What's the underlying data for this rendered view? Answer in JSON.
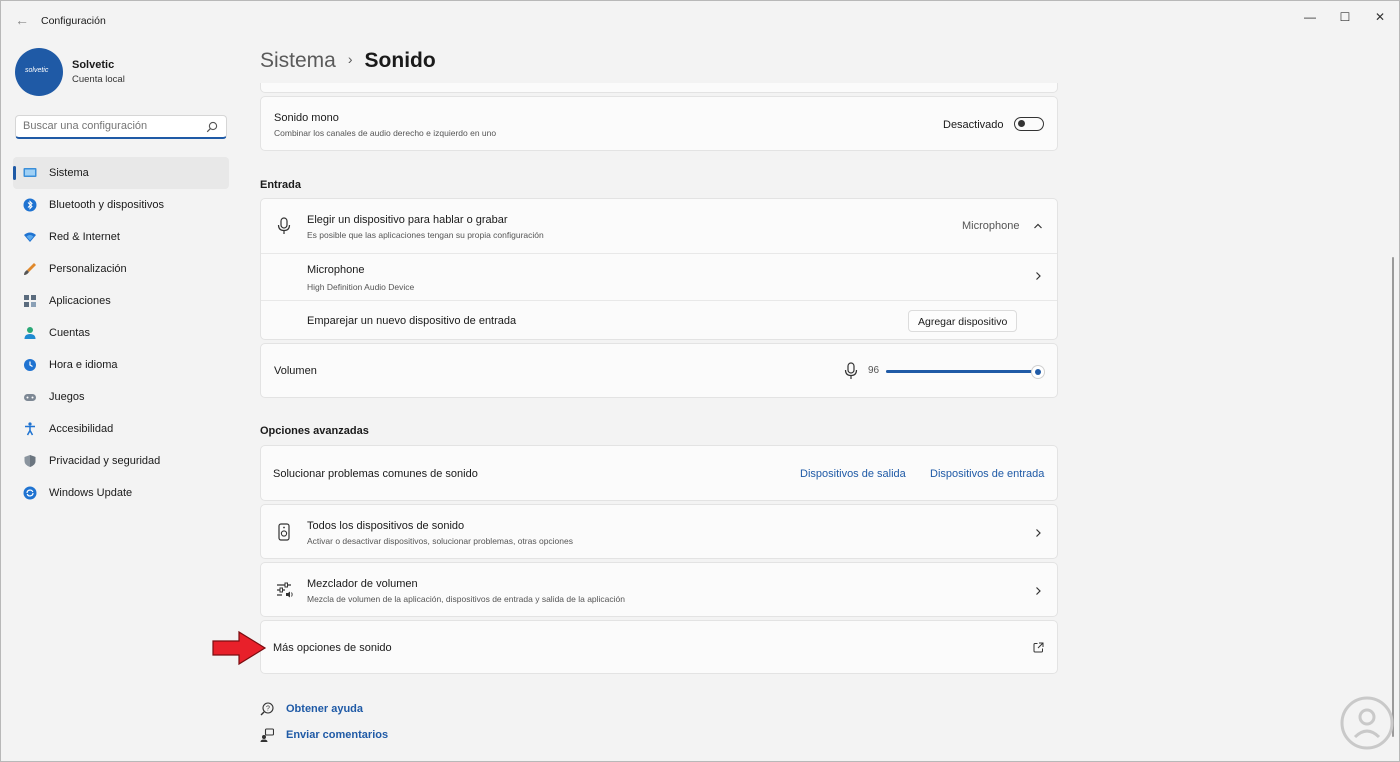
{
  "window": {
    "title": "Configuración",
    "back_icon": "arrow-left-icon",
    "controls": [
      "minimize-icon",
      "maximize-icon",
      "close-icon"
    ]
  },
  "user": {
    "avatar_text": "solvetic",
    "name": "Solvetic",
    "account_type": "Cuenta local"
  },
  "search": {
    "placeholder": "Buscar una configuración",
    "icon": "search-icon"
  },
  "sidebar": {
    "items": [
      {
        "label": "Sistema",
        "icon": "monitor-icon",
        "active": true
      },
      {
        "label": "Bluetooth y dispositivos",
        "icon": "bluetooth-icon"
      },
      {
        "label": "Red & Internet",
        "icon": "wifi-icon"
      },
      {
        "label": "Personalización",
        "icon": "brush-icon"
      },
      {
        "label": "Aplicaciones",
        "icon": "apps-icon"
      },
      {
        "label": "Cuentas",
        "icon": "person-icon"
      },
      {
        "label": "Hora e idioma",
        "icon": "clock-globe-icon"
      },
      {
        "label": "Juegos",
        "icon": "gamepad-icon"
      },
      {
        "label": "Accesibilidad",
        "icon": "accessibility-icon"
      },
      {
        "label": "Privacidad y seguridad",
        "icon": "shield-icon"
      },
      {
        "label": "Windows Update",
        "icon": "update-icon"
      }
    ]
  },
  "breadcrumb": {
    "parent": "Sistema",
    "separator": "›",
    "current": "Sonido"
  },
  "mono": {
    "title": "Sonido mono",
    "subtitle": "Combinar los canales de audio derecho e izquierdo en uno",
    "state_label": "Desactivado",
    "enabled": false
  },
  "input_section": {
    "heading": "Entrada",
    "choose": {
      "title": "Elegir un dispositivo para hablar o grabar",
      "subtitle": "Es posible que las aplicaciones tengan su propia configuración",
      "selected": "Microphone",
      "icon": "microphone-icon"
    },
    "device": {
      "title": "Microphone",
      "subtitle": "High Definition Audio Device"
    },
    "pair": {
      "title": "Emparejar un nuevo dispositivo de entrada",
      "button": "Agregar dispositivo"
    },
    "volume": {
      "label": "Volumen",
      "value": "96",
      "level": 96,
      "icon": "microphone-icon"
    }
  },
  "advanced": {
    "heading": "Opciones avanzadas",
    "troubleshoot": {
      "title": "Solucionar problemas comunes de sonido",
      "link_output": "Dispositivos de salida",
      "link_input": "Dispositivos de entrada"
    },
    "all_devices": {
      "title": "Todos los dispositivos de sonido",
      "subtitle": "Activar o desactivar dispositivos, solucionar problemas, otras opciones",
      "icon": "speaker-device-icon"
    },
    "mixer": {
      "title": "Mezclador de volumen",
      "subtitle": "Mezcla de volumen de la aplicación, dispositivos de entrada y salida de la aplicación",
      "icon": "mixer-icon"
    },
    "more": {
      "title": "Más opciones de sonido",
      "icon": "open-external-icon"
    }
  },
  "footer": {
    "help": {
      "label": "Obtener ayuda",
      "icon": "help-icon"
    },
    "feedback": {
      "label": "Enviar comentarios",
      "icon": "feedback-icon"
    }
  },
  "colors": {
    "accent": "#1f5aa6",
    "arrow": "#e8202a"
  }
}
